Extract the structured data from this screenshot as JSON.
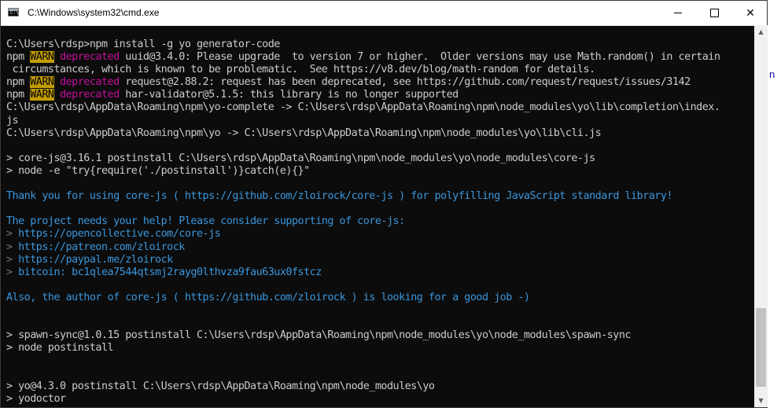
{
  "window": {
    "title": "C:\\Windows\\system32\\cmd.exe",
    "icon": "cmd-icon",
    "controls": {
      "minimize": "minimize-icon",
      "maximize": "maximize-icon",
      "close": "✕"
    }
  },
  "background_window": {
    "fragment_text": "n"
  },
  "console": {
    "colors": {
      "bg": "#0c0c0c",
      "text": "#cccccc",
      "warn_bg": "#c19c00",
      "deprecated": "#c50f9b",
      "cyan": "#3a96dd",
      "prompt_arrow": "#767676"
    },
    "lines": [
      {
        "segments": [
          {
            "t": "C:\\Users\\rdsp>npm install -g yo generator-code"
          }
        ]
      },
      {
        "segments": [
          {
            "t": "npm "
          },
          {
            "t": "WARN",
            "c": "warn"
          },
          {
            "t": " "
          },
          {
            "t": "deprecated",
            "c": "dep"
          },
          {
            "t": " uuid@3.4.0: Please upgrade  to version 7 or higher.  Older versions may use Math.random() in certain"
          }
        ]
      },
      {
        "segments": [
          {
            "t": " circumstances, which is known to be problematic.  See https://v8.dev/blog/math-random for details."
          }
        ]
      },
      {
        "segments": [
          {
            "t": "npm "
          },
          {
            "t": "WARN",
            "c": "warn"
          },
          {
            "t": " "
          },
          {
            "t": "deprecated",
            "c": "dep"
          },
          {
            "t": " request@2.88.2: request has been deprecated, see https://github.com/request/request/issues/3142"
          }
        ]
      },
      {
        "segments": [
          {
            "t": "npm "
          },
          {
            "t": "WARN",
            "c": "warn"
          },
          {
            "t": " "
          },
          {
            "t": "deprecated",
            "c": "dep"
          },
          {
            "t": " har-validator@5.1.5: this library is no longer supported"
          }
        ]
      },
      {
        "segments": [
          {
            "t": "C:\\Users\\rdsp\\AppData\\Roaming\\npm\\yo-complete -> C:\\Users\\rdsp\\AppData\\Roaming\\npm\\node_modules\\yo\\lib\\completion\\index."
          }
        ]
      },
      {
        "segments": [
          {
            "t": "js"
          }
        ]
      },
      {
        "segments": [
          {
            "t": "C:\\Users\\rdsp\\AppData\\Roaming\\npm\\yo -> C:\\Users\\rdsp\\AppData\\Roaming\\npm\\node_modules\\yo\\lib\\cli.js"
          }
        ]
      },
      {
        "segments": [
          {
            "t": ""
          }
        ]
      },
      {
        "segments": [
          {
            "t": "> core-js@3.16.1 postinstall C:\\Users\\rdsp\\AppData\\Roaming\\npm\\node_modules\\yo\\node_modules\\core-js"
          }
        ]
      },
      {
        "segments": [
          {
            "t": "> node -e \"try{require('./postinstall')}catch(e){}\""
          }
        ]
      },
      {
        "segments": [
          {
            "t": ""
          }
        ]
      },
      {
        "segments": [
          {
            "t": "Thank you for using core-js ( ",
            "c": "cyan"
          },
          {
            "t": "https://github.com/zloirock/core-js",
            "c": "cyan"
          },
          {
            "t": " ) for polyfilling JavaScript standard library!",
            "c": "cyan"
          }
        ]
      },
      {
        "segments": [
          {
            "t": ""
          }
        ]
      },
      {
        "segments": [
          {
            "t": "The project needs your help! Please consider supporting of core-js:",
            "c": "cyan"
          }
        ]
      },
      {
        "segments": [
          {
            "t": "> ",
            "c": "gray"
          },
          {
            "t": "https://opencollective.com/core-js",
            "c": "cyan"
          }
        ]
      },
      {
        "segments": [
          {
            "t": "> ",
            "c": "gray"
          },
          {
            "t": "https://patreon.com/zloirock",
            "c": "cyan"
          }
        ]
      },
      {
        "segments": [
          {
            "t": "> ",
            "c": "gray"
          },
          {
            "t": "https://paypal.me/zloirock",
            "c": "cyan"
          }
        ]
      },
      {
        "segments": [
          {
            "t": "> ",
            "c": "gray"
          },
          {
            "t": "bitcoin: bc1qlea7544qtsmj2rayg0lthvza9fau63ux0fstcz",
            "c": "cyan"
          }
        ]
      },
      {
        "segments": [
          {
            "t": ""
          }
        ]
      },
      {
        "segments": [
          {
            "t": "Also, the author of core-js ( ",
            "c": "cyan"
          },
          {
            "t": "https://github.com/zloirock",
            "c": "cyan"
          },
          {
            "t": " ) is looking for a good job -)",
            "c": "cyan"
          }
        ]
      },
      {
        "segments": [
          {
            "t": ""
          }
        ]
      },
      {
        "segments": [
          {
            "t": ""
          }
        ]
      },
      {
        "segments": [
          {
            "t": "> spawn-sync@1.0.15 postinstall C:\\Users\\rdsp\\AppData\\Roaming\\npm\\node_modules\\yo\\node_modules\\spawn-sync"
          }
        ]
      },
      {
        "segments": [
          {
            "t": "> node postinstall"
          }
        ]
      },
      {
        "segments": [
          {
            "t": ""
          }
        ]
      },
      {
        "segments": [
          {
            "t": ""
          }
        ]
      },
      {
        "segments": [
          {
            "t": "> yo@4.3.0 postinstall C:\\Users\\rdsp\\AppData\\Roaming\\npm\\node_modules\\yo"
          }
        ]
      },
      {
        "segments": [
          {
            "t": "> yodoctor"
          }
        ]
      }
    ]
  },
  "scrollbar": {
    "up_arrow": "▲",
    "down_arrow": "▼"
  }
}
